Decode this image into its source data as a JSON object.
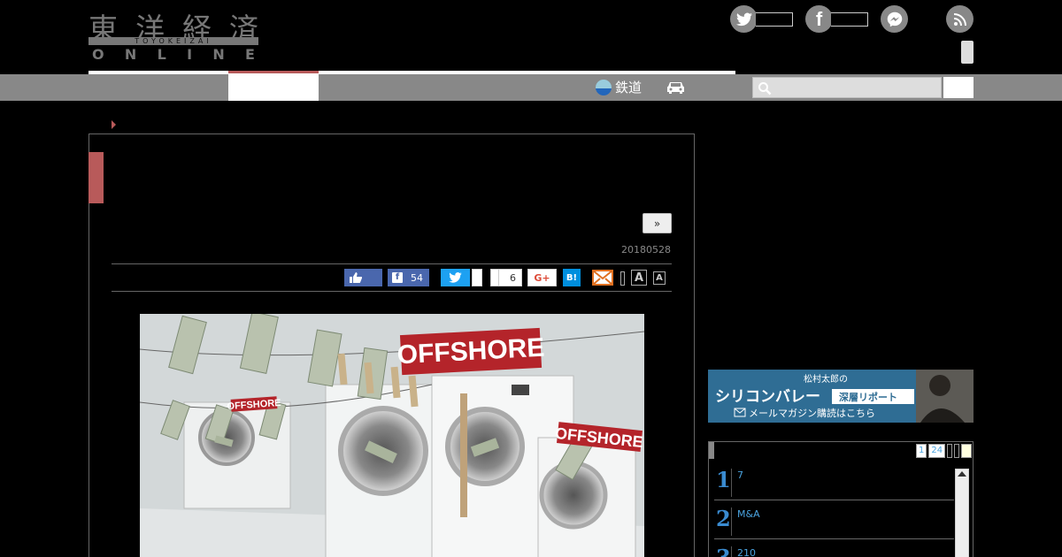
{
  "header": {
    "logo_kanji": [
      "東",
      "洋",
      "経",
      "済"
    ],
    "logo_band": "TOYOKEIZAI",
    "logo_online": [
      "O",
      "N",
      "L",
      "I",
      "N",
      "E"
    ],
    "social": [
      {
        "icon": "twitter-icon",
        "glyph": "🐦"
      },
      {
        "icon": "facebook-icon",
        "glyph": "f"
      },
      {
        "icon": "messenger-icon",
        "glyph": "⚡"
      }
    ],
    "rss_glyph": "◉"
  },
  "nav": {
    "rail_label": "鉄道"
  },
  "article": {
    "next_label": "»",
    "date": "20180528",
    "share": {
      "fb_count": "54",
      "hatena_count": "6",
      "gplus_label": "G+",
      "hatena_label": "B!",
      "font_large": "A",
      "font_small": "A"
    },
    "photo": {
      "sign_main": "OFFSHORE",
      "sign_left": "OFFSHORE",
      "sign_right": "OFFSHORE"
    }
  },
  "sidebar": {
    "banner": {
      "line1": "松村太郎の",
      "line2": "シリコンバレー",
      "line2_box": "深層リポート",
      "line3": "メールマガジン購読はこちら"
    },
    "ranking": {
      "pager": [
        "1",
        "24",
        "",
        "",
        ""
      ],
      "items": [
        {
          "num": "1",
          "label": "7"
        },
        {
          "num": "2",
          "label": "M&A"
        },
        {
          "num": "3",
          "label": "210"
        }
      ]
    }
  }
}
